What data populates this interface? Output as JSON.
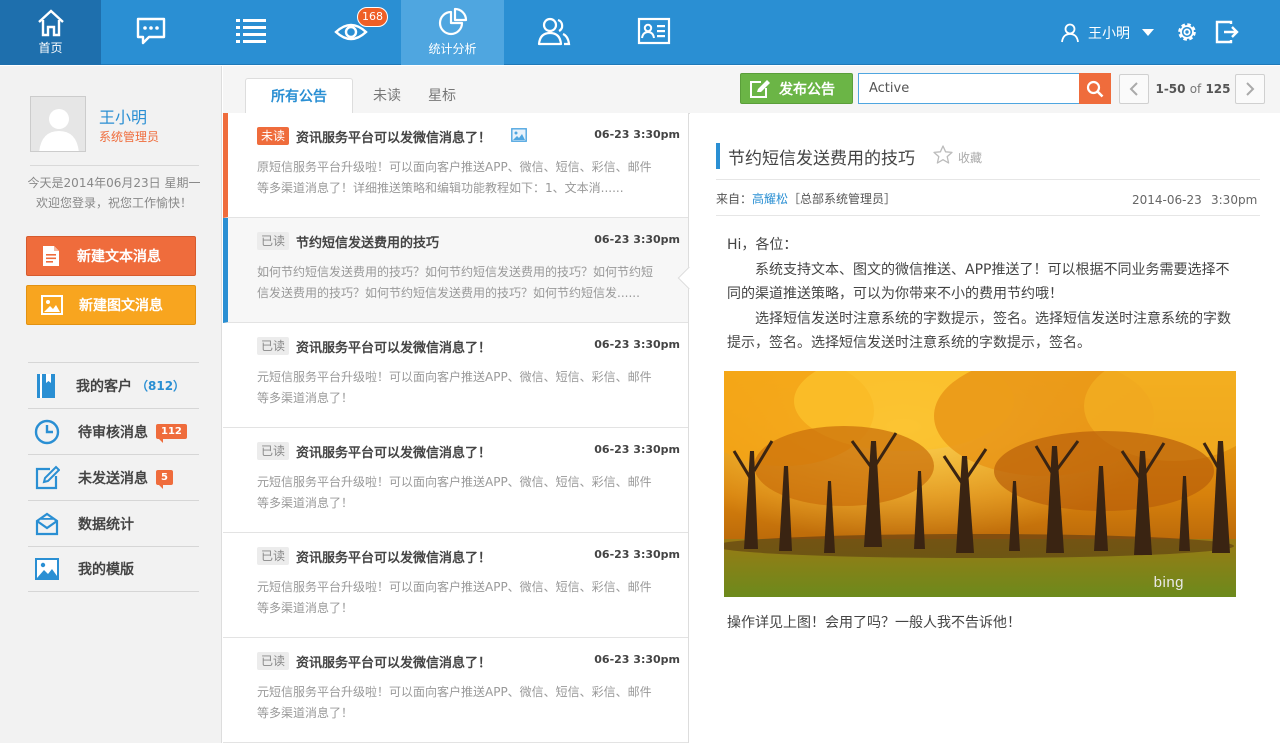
{
  "nav": {
    "home_label": "首页",
    "stats_label": "统计分析",
    "watch_badge": "168",
    "user_name": "王小明"
  },
  "profile": {
    "name": "王小明",
    "role": "系统管理员",
    "greeting_line1": "今天是2014年06月23日 星期一",
    "greeting_line2": "欢迎您登录，祝您工作愉快！"
  },
  "actions": {
    "new_text": "新建文本消息",
    "new_image": "新建图文消息"
  },
  "sidebar_menu": [
    {
      "label": "我的客户",
      "count": "（812）",
      "badge": ""
    },
    {
      "label": "待审核消息",
      "count": "",
      "badge": "112"
    },
    {
      "label": "未发送消息",
      "count": "",
      "badge": "5"
    },
    {
      "label": "数据统计",
      "count": "",
      "badge": ""
    },
    {
      "label": "我的模版",
      "count": "",
      "badge": ""
    }
  ],
  "tabs": {
    "all": "所有公告",
    "unread": "未读",
    "starred": "星标"
  },
  "toolbar": {
    "publish": "发布公告",
    "search_value": "Active",
    "pager_range": "1-50",
    "pager_of": "of",
    "pager_total": "125"
  },
  "messages": [
    {
      "tag": "未读",
      "title": "资讯服务平台可以发微信消息了！",
      "time": "06-23 3:30pm",
      "body_1": "原短信服务平台升级啦！可以面向客户推送APP、微信、短信、彩信、邮件",
      "body_2": "等多渠道消息了！详细推送策略和编辑功能教程如下：1、文本消......"
    },
    {
      "tag": "已读",
      "title": "节约短信发送费用的技巧",
      "time": "06-23 3:30pm",
      "body_1": "如何节约短信发送费用的技巧？如何节约短信发送费用的技巧？如何节约短",
      "body_2": "信发送费用的技巧？如何节约短信发送费用的技巧？如何节约短信发......"
    },
    {
      "tag": "已读",
      "title": "资讯服务平台可以发微信消息了！",
      "time": "06-23 3:30pm",
      "body_1": "元短信服务平台升级啦！可以面向客户推送APP、微信、短信、彩信、邮件",
      "body_2": "等多渠道消息了！"
    },
    {
      "tag": "已读",
      "title": "资讯服务平台可以发微信消息了！",
      "time": "06-23 3:30pm",
      "body_1": "元短信服务平台升级啦！可以面向客户推送APP、微信、短信、彩信、邮件",
      "body_2": "等多渠道消息了！"
    },
    {
      "tag": "已读",
      "title": "资讯服务平台可以发微信消息了！",
      "time": "06-23 3:30pm",
      "body_1": "元短信服务平台升级啦！可以面向客户推送APP、微信、短信、彩信、邮件",
      "body_2": "等多渠道消息了！"
    },
    {
      "tag": "已读",
      "title": "资讯服务平台可以发微信消息了！",
      "time": "06-23 3:30pm",
      "body_1": "元短信服务平台升级啦！可以面向客户推送APP、微信、短信、彩信、邮件",
      "body_2": "等多渠道消息了！"
    }
  ],
  "detail": {
    "title": "节约短信发送费用的技巧",
    "favorite": "收藏",
    "from_label": "来自：",
    "sender": "高耀松",
    "sender_dept": "［总部系统管理员］",
    "date": "2014-06-23",
    "time": "3:30pm",
    "greeting": "Hi，各位：",
    "para1": "系统支持文本、图文的微信推送、APP推送了！可以根据不同业务需要选择不同的渠道推送策略，可以为你带来不小的费用节约哦！",
    "para2": "选择短信发送时注意系统的字数提示，签名。选择短信发送时注意系统的字数提示，签名。选择短信发送时注意系统的字数提示，签名。",
    "photo_watermark": "bing",
    "caption": "操作详见上图！会用了吗？一般人我不告诉他！"
  },
  "colors": {
    "nav_blue": "#2a8fd3",
    "accent_orange": "#ef6c3c",
    "action_yellow": "#f8a51f",
    "publish_green": "#6bb546"
  }
}
